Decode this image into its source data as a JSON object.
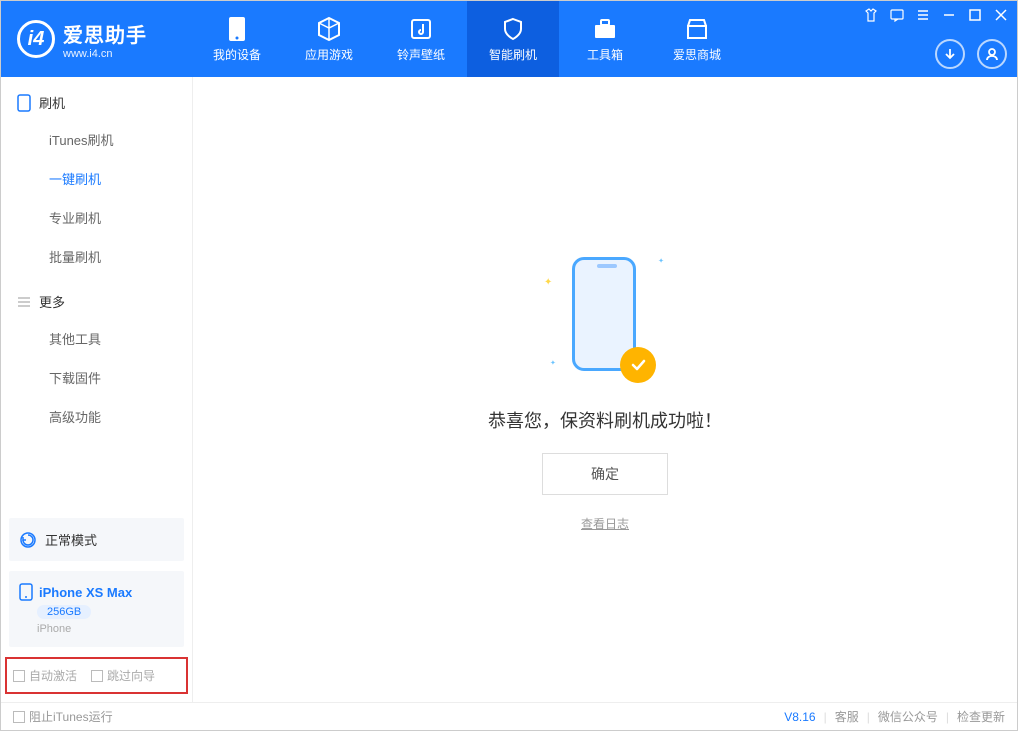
{
  "app": {
    "name": "爱思助手",
    "url": "www.i4.cn"
  },
  "tabs": [
    {
      "label": "我的设备"
    },
    {
      "label": "应用游戏"
    },
    {
      "label": "铃声壁纸"
    },
    {
      "label": "智能刷机"
    },
    {
      "label": "工具箱"
    },
    {
      "label": "爱思商城"
    }
  ],
  "sidebar": {
    "group1_title": "刷机",
    "group1_items": [
      "iTunes刷机",
      "一键刷机",
      "专业刷机",
      "批量刷机"
    ],
    "group2_title": "更多",
    "group2_items": [
      "其他工具",
      "下载固件",
      "高级功能"
    ]
  },
  "mode": "正常模式",
  "device": {
    "name": "iPhone XS Max",
    "storage": "256GB",
    "type": "iPhone"
  },
  "checkboxes": {
    "auto_activate": "自动激活",
    "skip_guide": "跳过向导"
  },
  "content": {
    "success_msg": "恭喜您，保资料刷机成功啦！",
    "confirm": "确定",
    "view_log": "查看日志"
  },
  "footer": {
    "block_itunes": "阻止iTunes运行",
    "version": "V8.16",
    "support": "客服",
    "wechat": "微信公众号",
    "update": "检查更新"
  }
}
